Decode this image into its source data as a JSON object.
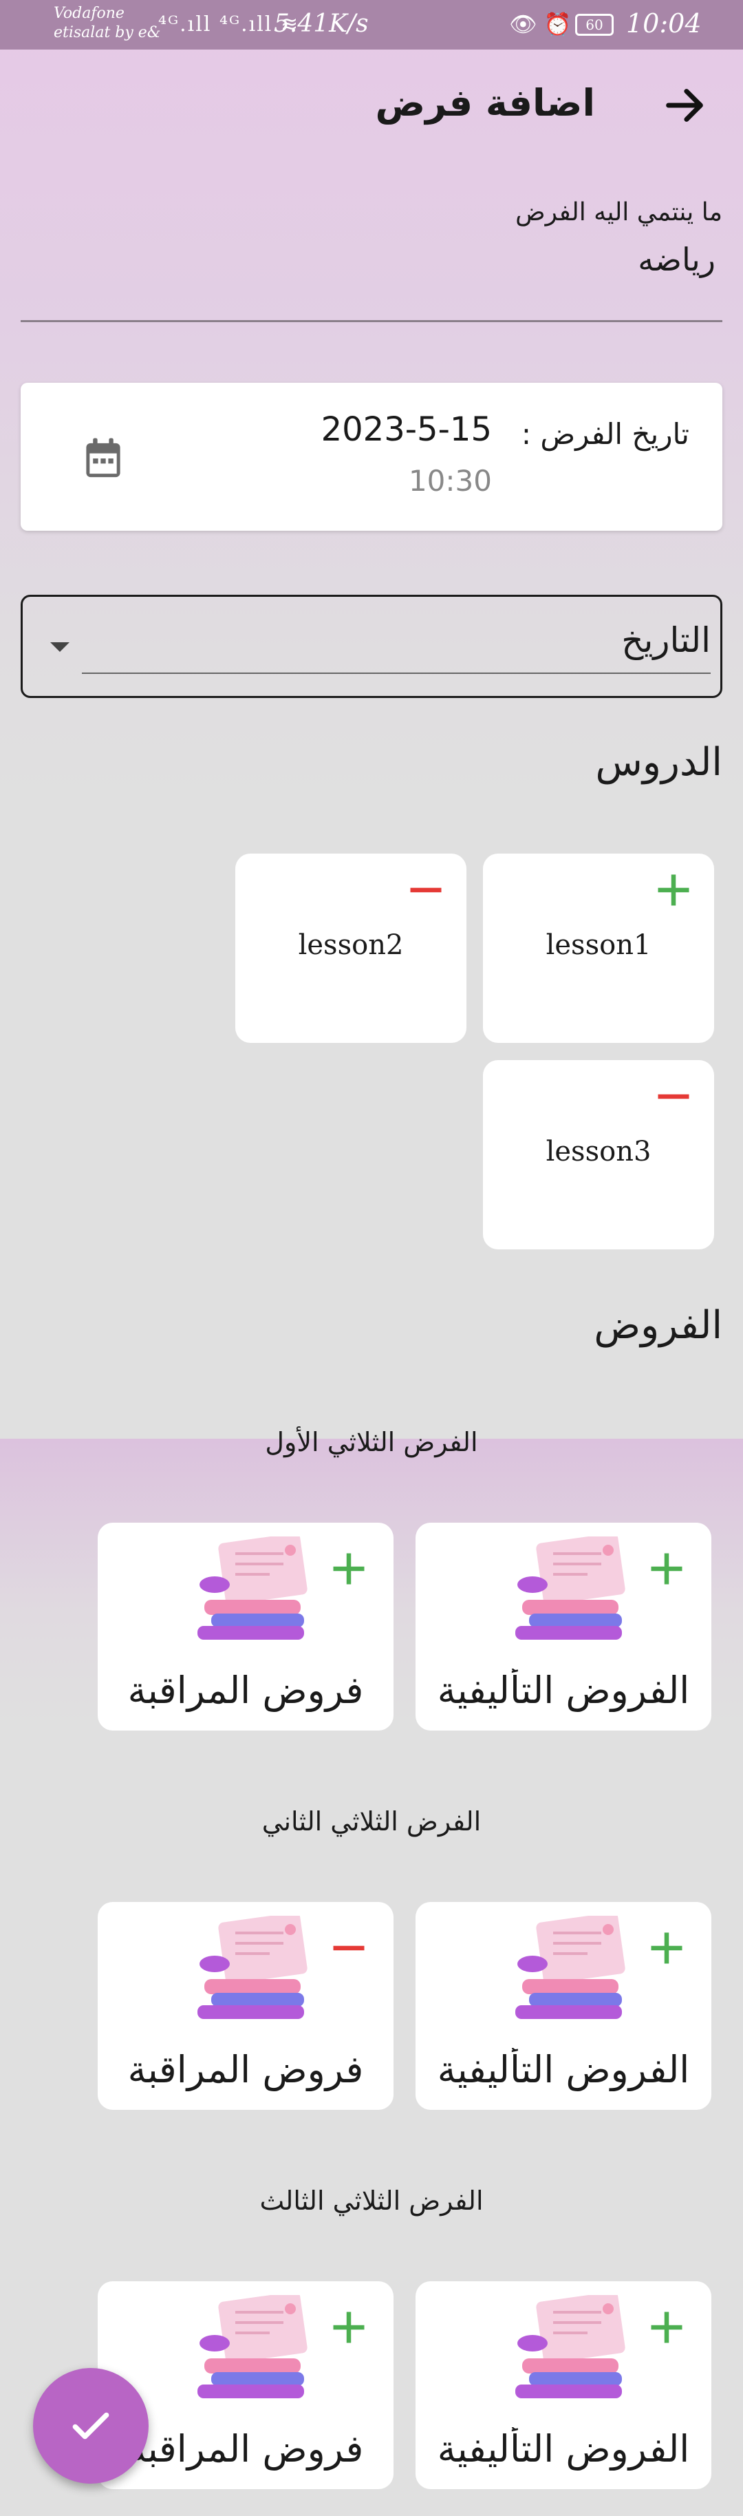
{
  "status_bar": {
    "carrier_line1": "Vodafone",
    "carrier_line2": "etisalat by e&",
    "signals": "⁴ᴳ.ıll ⁴ᴳ.ıll ≋",
    "speed": "5.41K/s",
    "icons": "👁 ⏰",
    "battery": "60",
    "time": "10:04"
  },
  "header": {
    "title": "اضافة فرض"
  },
  "belongs_to": {
    "label": "ما ينتمي اليه الفرض",
    "value": "رياضه"
  },
  "date_card": {
    "label": "تاريخ الفرض :",
    "date": "2023-5-15",
    "time": "10:30"
  },
  "dropdown": {
    "value": "التاريخ"
  },
  "lessons_title": "الدروس",
  "lessons": [
    {
      "label": "lesson1",
      "action": "add"
    },
    {
      "label": "lesson2",
      "action": "remove"
    },
    {
      "label": "lesson3",
      "action": "remove"
    }
  ],
  "exams_title": "الفروض",
  "terms": [
    {
      "title": "الفرض الثلاثي الأول",
      "cards": [
        {
          "label": "الفروض التأليفية",
          "action": "add"
        },
        {
          "label": "فروض المراقبة",
          "action": "add"
        }
      ]
    },
    {
      "title": "الفرض الثلاثي الثاني",
      "cards": [
        {
          "label": "الفروض التأليفية",
          "action": "add"
        },
        {
          "label": "فروض المراقبة",
          "action": "remove"
        }
      ]
    },
    {
      "title": "الفرض الثلاثي الثالث",
      "cards": [
        {
          "label": "الفروض التأليفية",
          "action": "add"
        },
        {
          "label": "فروض المراقبة",
          "action": "add"
        }
      ]
    }
  ],
  "colors": {
    "add": "#4caf50",
    "remove": "#e53935",
    "fab": "#b865c5"
  },
  "icons": {
    "back": "arrow-right-icon",
    "calendar": "calendar-icon",
    "fab": "check-icon",
    "exam_art": "books-icon"
  }
}
